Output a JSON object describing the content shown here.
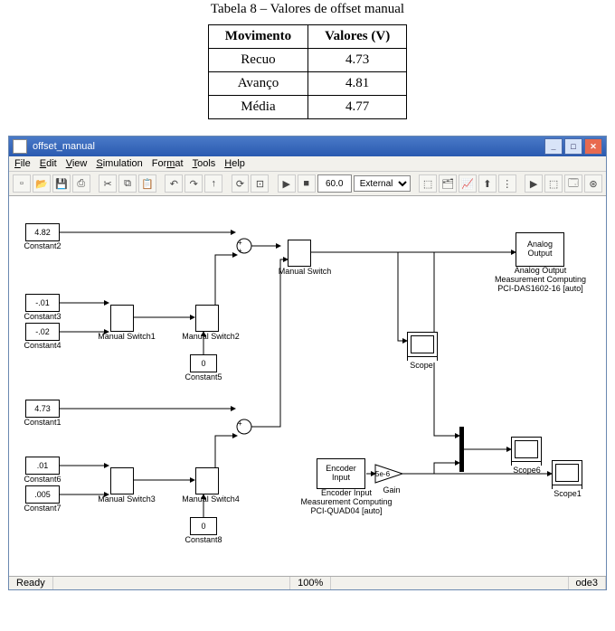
{
  "caption": "Tabela 8 – Valores de offset manual",
  "table": {
    "head": [
      "Movimento",
      "Valores (V)"
    ],
    "rows": [
      [
        "Recuo",
        "4.73"
      ],
      [
        "Avanço",
        "4.81"
      ],
      [
        "Média",
        "4.77"
      ]
    ]
  },
  "window": {
    "title": "offset_manual",
    "menus": [
      "File",
      "Edit",
      "View",
      "Simulation",
      "Format",
      "Tools",
      "Help"
    ],
    "stop_time": "60.0",
    "mode": "External",
    "status": {
      "left": "Ready",
      "zoom": "100%",
      "solver": "ode3"
    }
  },
  "blocks": {
    "constant2": {
      "value": "4.82",
      "label": "Constant2"
    },
    "constant3": {
      "value": "-.01",
      "label": "Constant3"
    },
    "constant4": {
      "value": "-.02",
      "label": "Constant4"
    },
    "constant5": {
      "value": "0",
      "label": "Constant5"
    },
    "constant1": {
      "value": "4.73",
      "label": "Constant1"
    },
    "constant6": {
      "value": ".01",
      "label": "Constant6"
    },
    "constant7": {
      "value": ".005",
      "label": "Constant7"
    },
    "constant8": {
      "value": "0",
      "label": "Constant8"
    },
    "msw": {
      "label": "Manual Switch"
    },
    "msw1": {
      "label": "Manual Switch1"
    },
    "msw2": {
      "label": "Manual Switch2"
    },
    "msw3": {
      "label": "Manual Switch3"
    },
    "msw4": {
      "label": "Manual Switch4"
    },
    "analog": {
      "line1": "Analog",
      "line2": "Output",
      "label1": "Analog Output",
      "label2": "Measurement Computing",
      "label3": "PCI-DAS1602-16 [auto]"
    },
    "encoder": {
      "line1": "Encoder",
      "line2": "Input",
      "label1": "Encoder Input",
      "label2": "Measurement Computing",
      "label3": "PCI-QUAD04 [auto]"
    },
    "gain": {
      "value": "5e-6",
      "label": "Gain"
    },
    "scope": {
      "label": "Scope"
    },
    "scope6": {
      "label": "Scope6"
    },
    "scope1": {
      "label": "Scope1"
    }
  }
}
